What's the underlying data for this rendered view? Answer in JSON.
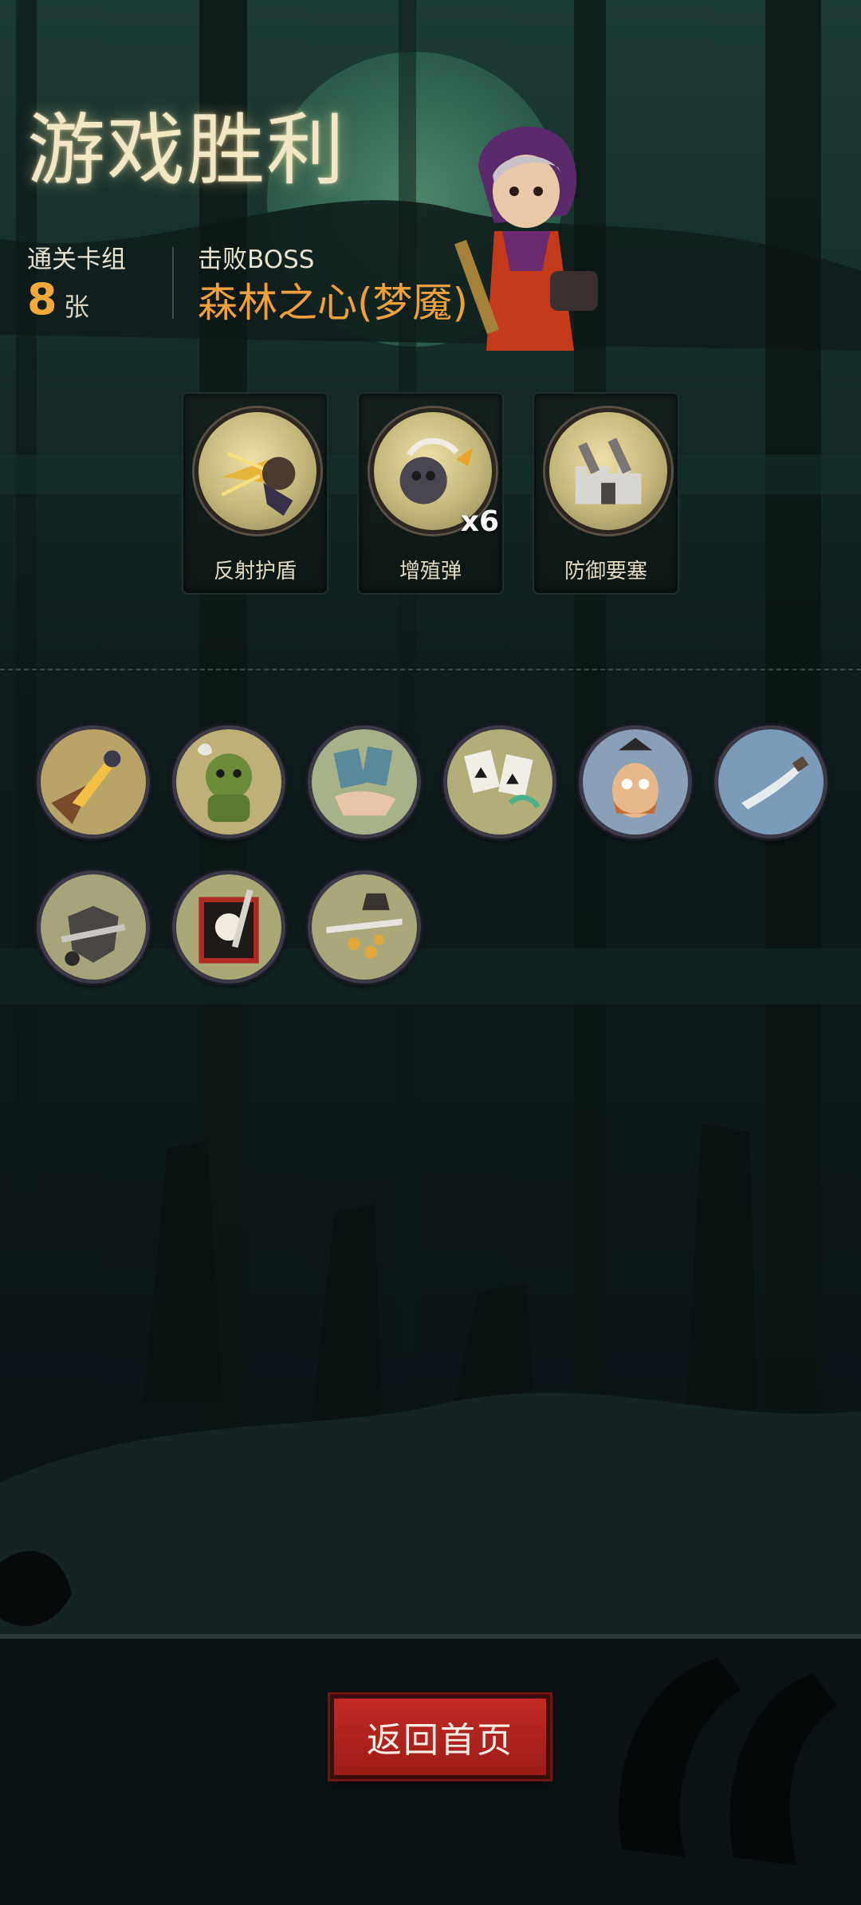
{
  "result": {
    "title": "游戏胜利",
    "deck_label": "通关卡组",
    "deck_count": "8",
    "deck_unit": "张",
    "boss_label": "击败BOSS",
    "boss_name": "森林之心(梦魇)"
  },
  "relics": [
    {
      "label": "反射护盾",
      "icon": "reflect-shield-icon"
    },
    {
      "label": "增殖弹",
      "icon": "multiplying-bomb-icon",
      "count": "x6"
    },
    {
      "label": "防御要塞",
      "icon": "defense-fortress-icon"
    }
  ],
  "deck_cards": [
    {
      "icon": "fire-slash-card-icon"
    },
    {
      "icon": "green-ogre-card-icon"
    },
    {
      "icon": "card-hand-card-icon"
    },
    {
      "icon": "spade-cards-card-icon"
    },
    {
      "icon": "pirate-crew-card-icon"
    },
    {
      "icon": "dagger-card-icon"
    },
    {
      "icon": "broken-shield-card-icon"
    },
    {
      "icon": "skull-card-icon"
    },
    {
      "icon": "gold-coins-card-icon"
    }
  ],
  "actions": {
    "return_home": "返回首页"
  },
  "colors": {
    "accent_orange": "#f0a03a",
    "button_red": "#b82420",
    "title_cream": "#f2e7c4"
  }
}
